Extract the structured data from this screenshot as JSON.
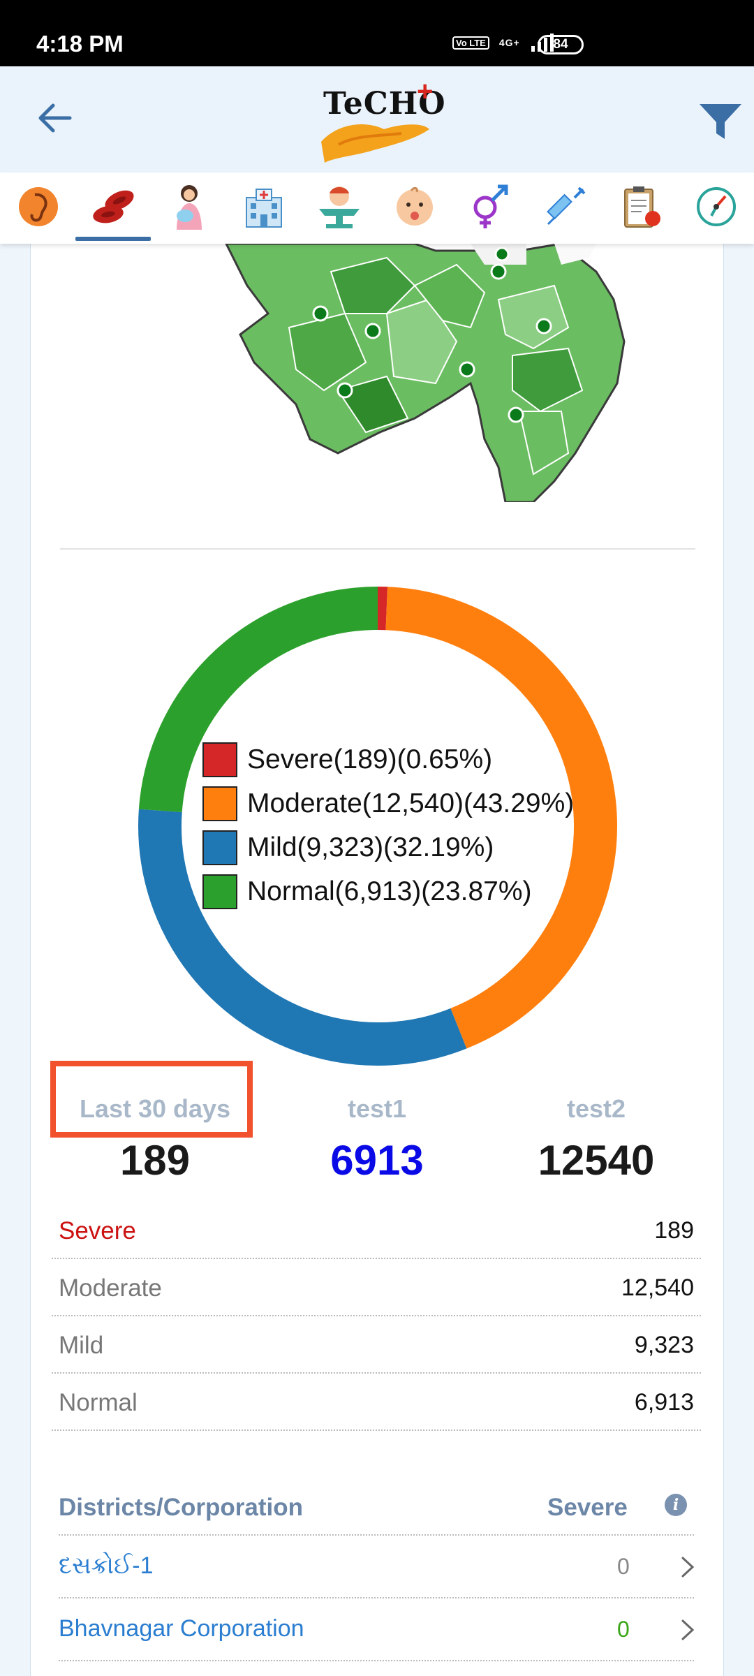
{
  "status_bar": {
    "time": "4:18 PM",
    "volte": "Vo LTE",
    "network": "4G+",
    "battery": "84"
  },
  "app": {
    "logo_text": "TeCHO",
    "logo_plus": "+"
  },
  "tabs": [
    {
      "icon": "ear-icon"
    },
    {
      "icon": "blood-cells-icon",
      "active": true
    },
    {
      "icon": "mother-baby-icon"
    },
    {
      "icon": "hospital-icon"
    },
    {
      "icon": "baby-scale-icon"
    },
    {
      "icon": "baby-face-icon"
    },
    {
      "icon": "gender-icon"
    },
    {
      "icon": "syringe-icon"
    },
    {
      "icon": "clipboard-icon"
    },
    {
      "icon": "compass-icon"
    }
  ],
  "chart_data": {
    "type": "pie",
    "style": "donut",
    "categories": [
      "Severe",
      "Moderate",
      "Mild",
      "Normal"
    ],
    "values": [
      189,
      12540,
      9323,
      6913
    ],
    "percentages": [
      0.65,
      43.29,
      32.19,
      23.87
    ],
    "colors": [
      "#d62728",
      "#ff7f0e",
      "#1f77b4",
      "#2ca02c"
    ],
    "legend": [
      "Severe(189)(0.65%)",
      "Moderate(12,540)(43.29%)",
      "Mild(9,323)(32.19%)",
      "Normal(6,913)(23.87%)"
    ]
  },
  "stats": [
    {
      "label": "Last 30 days",
      "value": "189",
      "color": "#1a1a1a"
    },
    {
      "label": "test1",
      "value": "6913",
      "color": "#0a0ae6"
    },
    {
      "label": "test2",
      "value": "12540",
      "color": "#1a1a1a"
    }
  ],
  "table": [
    {
      "label": "Severe",
      "value": "189"
    },
    {
      "label": "Moderate",
      "value": "12,540"
    },
    {
      "label": "Mild",
      "value": "9,323"
    },
    {
      "label": "Normal",
      "value": "6,913"
    }
  ],
  "districts": {
    "header": "Districts/Corporation",
    "column": "Severe",
    "info_icon": "i",
    "rows": [
      {
        "name": "દસક્રોઈ-1",
        "count": "0",
        "count_color": "#888888"
      },
      {
        "name": "Bhavnagar Corporation",
        "count": "0",
        "count_color": "#3aa517"
      }
    ]
  }
}
